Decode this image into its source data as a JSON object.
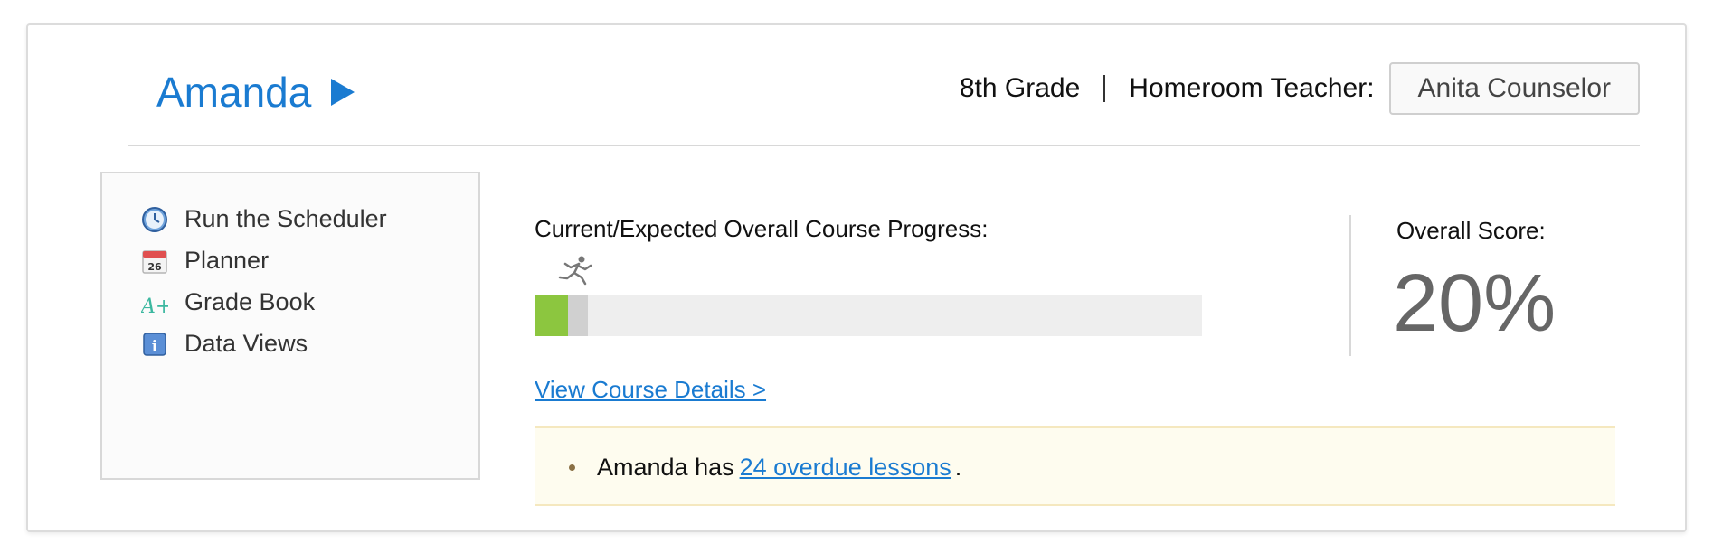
{
  "header": {
    "student_name": "Amanda",
    "grade": "8th Grade",
    "teacher_label": "Homeroom Teacher:",
    "teacher_name": "Anita Counselor"
  },
  "sidebar": {
    "items": [
      {
        "label": "Run the Scheduler",
        "icon": "clock-icon"
      },
      {
        "label": "Planner",
        "icon": "calendar-icon",
        "icon_text": "26"
      },
      {
        "label": "Grade Book",
        "icon": "grade-aplus-icon",
        "icon_text": "A+"
      },
      {
        "label": "Data Views",
        "icon": "info-icon",
        "icon_text": "i"
      }
    ]
  },
  "progress": {
    "label": "Current/Expected Overall Course Progress:",
    "current_fraction": 0.05,
    "expected_fraction": 0.08,
    "course_link": "View Course Details >"
  },
  "score": {
    "label": "Overall Score:",
    "value": "20%"
  },
  "alert": {
    "prefix": "Amanda has",
    "link": "24 overdue lessons",
    "suffix": "."
  },
  "colors": {
    "accent": "#1a7bd1",
    "progress_current": "#8cc63f",
    "progress_expected": "#d0d0d0",
    "alert_background": "#fefcef"
  }
}
